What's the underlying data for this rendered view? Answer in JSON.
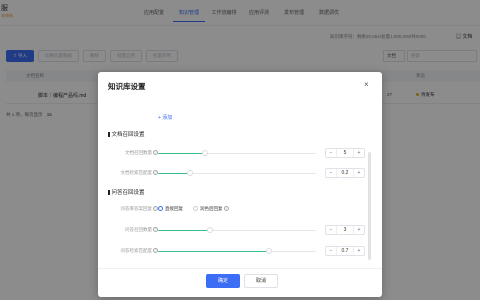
{
  "app": {
    "title": "服",
    "subtitle": "未审核"
  },
  "nav": [
    {
      "label": "应用配置",
      "active": false
    },
    {
      "label": "知识管理",
      "active": true
    },
    {
      "label": "工作流编排",
      "active": false
    },
    {
      "label": "应用评测",
      "active": false
    },
    {
      "label": "发布管理",
      "active": false
    },
    {
      "label": "数据调优",
      "active": false
    }
  ],
  "usage_text": "知识库字符：剩余20,864/总量1,000,000/共0000",
  "doc_link": "文档",
  "toolbar": {
    "import_label": "导入",
    "buttons": [
      "切换向量数据",
      "删除",
      "批量启用",
      "批量停用"
    ]
  },
  "filter_label": "文档",
  "search_placeholder": "搜索",
  "table": {
    "headers": [
      "文档名称",
      "状态"
    ],
    "rows": [
      {
        "name": "脚本｜编程产品吗.md",
        "date": "27",
        "status": "待发布"
      }
    ]
  },
  "pager": {
    "text": "共 1 项，每页显示",
    "size": "15"
  },
  "modal": {
    "title": "知识库设置",
    "add_label": "+ 添加",
    "doc_section": {
      "title": "文档召回设置",
      "doc_count_label": "文档召回数量",
      "doc_count_value": "5",
      "doc_count_fraction": 0.3,
      "doc_sim_label": "文档检索匹配度",
      "doc_sim_value": "0.2",
      "doc_sim_fraction": 0.2
    },
    "qa_section": {
      "title": "问答召回设置",
      "reply_label": "问答库答案回复",
      "reply_options": [
        "直接回复",
        "润色后回复"
      ],
      "reply_selected": "直接回复",
      "qa_count_label": "问答召回数量",
      "qa_count_value": "3",
      "qa_count_fraction": 0.33,
      "qa_sim_label": "问答检索匹配度",
      "qa_sim_value": "0.7",
      "qa_sim_fraction": 0.7
    },
    "ok_label": "确定",
    "cancel_label": "取消"
  },
  "colors": {
    "accent": "#3b6df5",
    "slider": "#3bbf8a",
    "status_pending": "#e8b12a"
  }
}
